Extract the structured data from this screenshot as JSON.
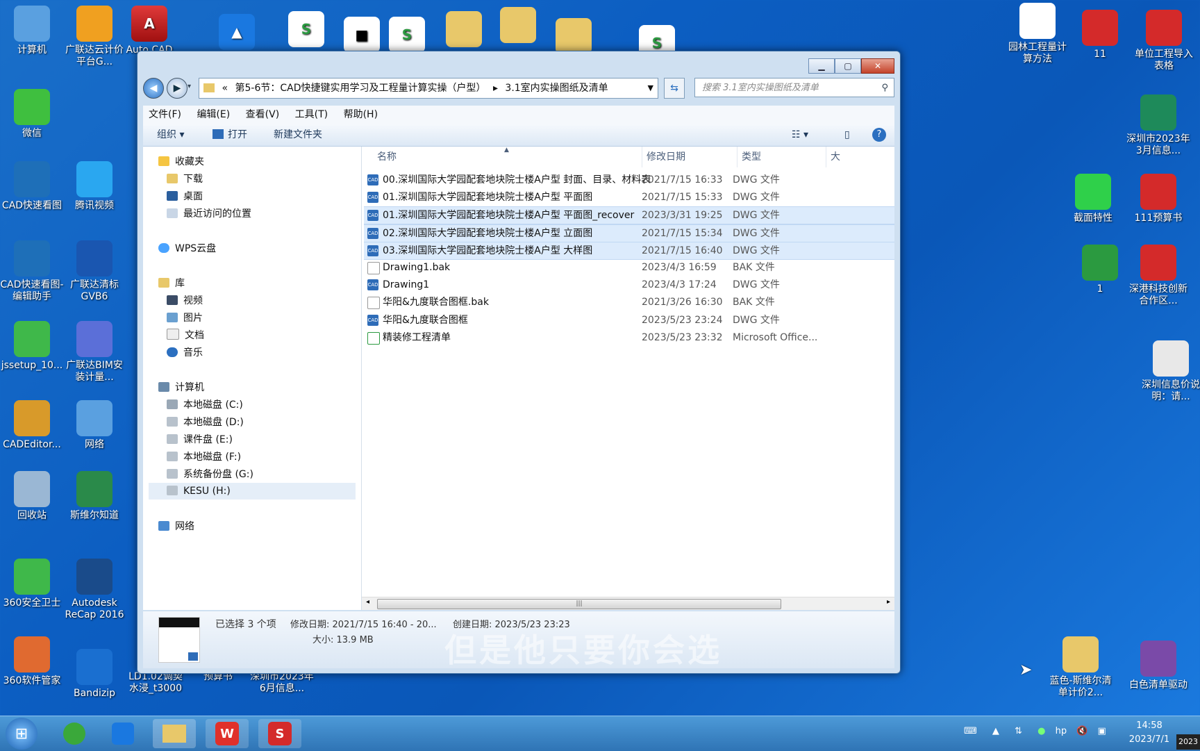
{
  "desktop_left": [
    {
      "label": "计算机",
      "icon": "computer-icon",
      "color": "#5aa0e0"
    },
    {
      "label": "广联达云计价平台G...",
      "icon": "glodon-cloud-icon",
      "color": "#f0a020"
    },
    {
      "label": "微信",
      "icon": "wechat-icon",
      "color": "#3fbf3f"
    },
    {
      "label": "CAD快速看图",
      "icon": "cad-viewer-icon",
      "color": "#1e6fb8"
    },
    {
      "label": "腾讯视频",
      "icon": "tencent-video-icon",
      "color": "#2aa7f0"
    },
    {
      "label": "CAD快速看图-编辑助手",
      "icon": "cad-editor-helper-icon",
      "color": "#1e6fb8"
    },
    {
      "label": "广联达清标GVB6",
      "icon": "glodon-gvb6-icon",
      "color": "#1a56b0"
    },
    {
      "label": "jssetup_10...",
      "icon": "download-icon",
      "color": "#3fb84a"
    },
    {
      "label": "广联达BIM安装计量...",
      "icon": "glodon-bim-icon",
      "color": "#5b6fd8"
    },
    {
      "label": "CADEditor...",
      "icon": "cadeditor-icon",
      "color": "#d89a2a"
    },
    {
      "label": "网络",
      "icon": "network-icon",
      "color": "#5aa0e0"
    },
    {
      "label": "回收站",
      "icon": "recycle-bin-icon",
      "color": "#9ab7d4"
    },
    {
      "label": "斯维尔知道",
      "icon": "thsware-know-icon",
      "color": "#2a8a4a"
    },
    {
      "label": "360安全卫士",
      "icon": "360-safe-icon",
      "color": "#3fb84a"
    },
    {
      "label": "Autodesk ReCap 2016",
      "icon": "recap-icon",
      "color": "#1a4b8a"
    },
    {
      "label": "360软件管家",
      "icon": "360-software-icon",
      "color": "#e06a30"
    },
    {
      "label": "Bandizip",
      "icon": "bandizip-icon",
      "color": "#1a6fd0"
    }
  ],
  "desktop_top": [
    {
      "label": "Auto CAD 20...",
      "icon": "autocad-icon"
    }
  ],
  "desktop_bottom": [
    {
      "label": "LD1.02调契水浸_t3000"
    },
    {
      "label": "预算书"
    },
    {
      "label": "深圳市2023年6月信息..."
    }
  ],
  "desktop_right": [
    {
      "label": "园林工程量计算方法",
      "icon": "doc-thumb-icon",
      "color": "#ffffff"
    },
    {
      "label": "11",
      "icon": "thsware-icon",
      "color": "#d42a2a"
    },
    {
      "label": "单位工程导入表格",
      "icon": "thsware-icon",
      "color": "#d42a2a"
    },
    {
      "label": "深圳市2023年3月信息...",
      "icon": "price-icon",
      "color": "#1e8a5a"
    },
    {
      "label": "截面特性",
      "icon": "section-icon",
      "color": "#2fd04a"
    },
    {
      "label": "111预算书",
      "icon": "thsware-icon",
      "color": "#d42a2a"
    },
    {
      "label": "1",
      "icon": "wps-sheet-icon",
      "color": "#2b9a40"
    },
    {
      "label": "深港科技创新合作区...",
      "icon": "thsware-icon",
      "color": "#d42a2a"
    },
    {
      "label": "深圳信息价说明：请...",
      "icon": "text-file-icon",
      "color": "#e8e8e8"
    },
    {
      "label": "蓝色-斯维尔清单计价2...",
      "icon": "folder-icon",
      "color": "#e8c86a"
    },
    {
      "label": "白色清单驱动",
      "icon": "rar-icon",
      "color": "#7a4aa8"
    }
  ],
  "window": {
    "breadcrumb_prefix": "«",
    "breadcrumb_1": "第5-6节：CAD快捷键实用学习及工程量计算实操（户型）",
    "breadcrumb_sep": "▸",
    "breadcrumb_2": "3.1室内实操图纸及清单",
    "search_placeholder": "搜索 3.1室内实操图纸及清单",
    "menu": [
      "文件(F)",
      "编辑(E)",
      "查看(V)",
      "工具(T)",
      "帮助(H)"
    ],
    "toolbar": {
      "organize": "组织 ▾",
      "open": "打开",
      "new_folder": "新建文件夹"
    },
    "nav": {
      "favorites": "收藏夹",
      "downloads": "下载",
      "desktop": "桌面",
      "recent": "最近访问的位置",
      "wps": "WPS云盘",
      "library": "库",
      "videos": "视频",
      "pictures": "图片",
      "docs": "文档",
      "music": "音乐",
      "computer": "计算机",
      "c": "本地磁盘 (C:)",
      "d": "本地磁盘 (D:)",
      "e": "课件盘 (E:)",
      "f": "本地磁盘 (F:)",
      "g": "系统备份盘 (G:)",
      "h": "KESU (H:)",
      "network": "网络"
    },
    "columns": {
      "name": "名称",
      "date": "修改日期",
      "type": "类型",
      "size": "大"
    },
    "files": [
      {
        "name": "00.深圳国际大学园配套地块院士楼A户型 封面、目录、材料表",
        "date": "2021/7/15 16:33",
        "type": "DWG 文件",
        "kind": "CAD",
        "selected": false
      },
      {
        "name": "01.深圳国际大学园配套地块院士楼A户型 平面图",
        "date": "2021/7/15 15:33",
        "type": "DWG 文件",
        "kind": "CAD",
        "selected": false
      },
      {
        "name": "01.深圳国际大学园配套地块院士楼A户型 平面图_recover",
        "date": "2023/3/31 19:25",
        "type": "DWG 文件",
        "kind": "CAD",
        "selected": true
      },
      {
        "name": "02.深圳国际大学园配套地块院士楼A户型 立面图",
        "date": "2021/7/15 15:34",
        "type": "DWG 文件",
        "kind": "CAD",
        "selected": true
      },
      {
        "name": "03.深圳国际大学园配套地块院士楼A户型 大样图",
        "date": "2021/7/15 16:40",
        "type": "DWG 文件",
        "kind": "CAD",
        "selected": true
      },
      {
        "name": "Drawing1.bak",
        "date": "2023/4/3 16:59",
        "type": "BAK 文件",
        "kind": "BAK",
        "selected": false
      },
      {
        "name": "Drawing1",
        "date": "2023/4/3 17:24",
        "type": "DWG 文件",
        "kind": "CAD",
        "selected": false
      },
      {
        "name": "华阳&九度联合图框.bak",
        "date": "2021/3/26 16:30",
        "type": "BAK 文件",
        "kind": "BAK",
        "selected": false
      },
      {
        "name": "华阳&九度联合图框",
        "date": "2023/5/23 23:24",
        "type": "DWG 文件",
        "kind": "CAD",
        "selected": false
      },
      {
        "name": "精装修工程清单",
        "date": "2023/5/23 23:32",
        "type": "Microsoft Office...",
        "kind": "XLS",
        "selected": false
      }
    ],
    "details": {
      "selected": "已选择 3 个项",
      "modified": "修改日期: 2021/7/15 16:40 - 20...",
      "created": "创建日期: 2023/5/23 23:23",
      "size": "大小: 13.9 MB"
    }
  },
  "subtitle": "但是他只要你会选",
  "clock": {
    "time": "14:58",
    "date": "2023/7/1",
    "corner": "2023"
  }
}
